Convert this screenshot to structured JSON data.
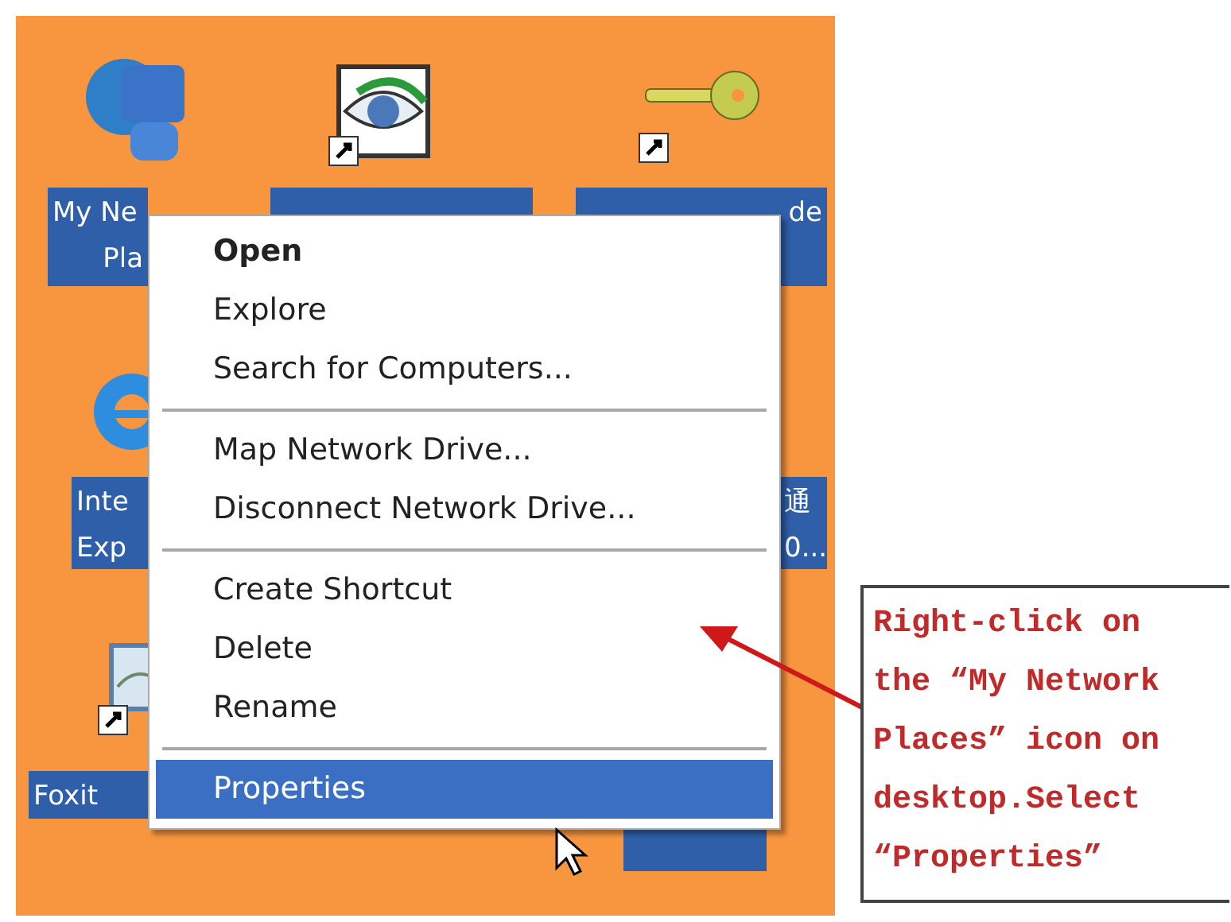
{
  "desktop": {
    "icons": [
      {
        "kind": "network",
        "lines": [
          "My Ne",
          "Pla"
        ]
      },
      {
        "kind": "eye-shortcut"
      },
      {
        "kind": "key-shortcut",
        "lines": [
          "de"
        ]
      },
      {
        "kind": "browser",
        "lines": [
          "Inte",
          "Exp"
        ]
      },
      {
        "kind": "covered",
        "lines": [
          "通",
          "0..."
        ]
      },
      {
        "kind": "document-shortcut",
        "lines": [
          "Foxit"
        ]
      },
      {
        "kind": "covered"
      }
    ]
  },
  "context_menu": {
    "items": [
      {
        "kind": "item",
        "label": "Open",
        "default": true,
        "selected": false
      },
      {
        "kind": "item",
        "label": "Explore",
        "default": false,
        "selected": false
      },
      {
        "kind": "item",
        "label": "Search for Computers...",
        "default": false,
        "selected": false
      },
      {
        "kind": "separator"
      },
      {
        "kind": "item",
        "label": "Map Network Drive...",
        "default": false,
        "selected": false
      },
      {
        "kind": "item",
        "label": "Disconnect Network Drive...",
        "default": false,
        "selected": false
      },
      {
        "kind": "separator"
      },
      {
        "kind": "item",
        "label": "Create Shortcut",
        "default": false,
        "selected": false
      },
      {
        "kind": "item",
        "label": "Delete",
        "default": false,
        "selected": false
      },
      {
        "kind": "item",
        "label": "Rename",
        "default": false,
        "selected": false
      },
      {
        "kind": "separator"
      },
      {
        "kind": "item",
        "label": "Properties",
        "default": false,
        "selected": true
      }
    ]
  },
  "annotation": {
    "text": "Right-click on the “My Network Places” icon on desktop.Select “Properties”"
  }
}
